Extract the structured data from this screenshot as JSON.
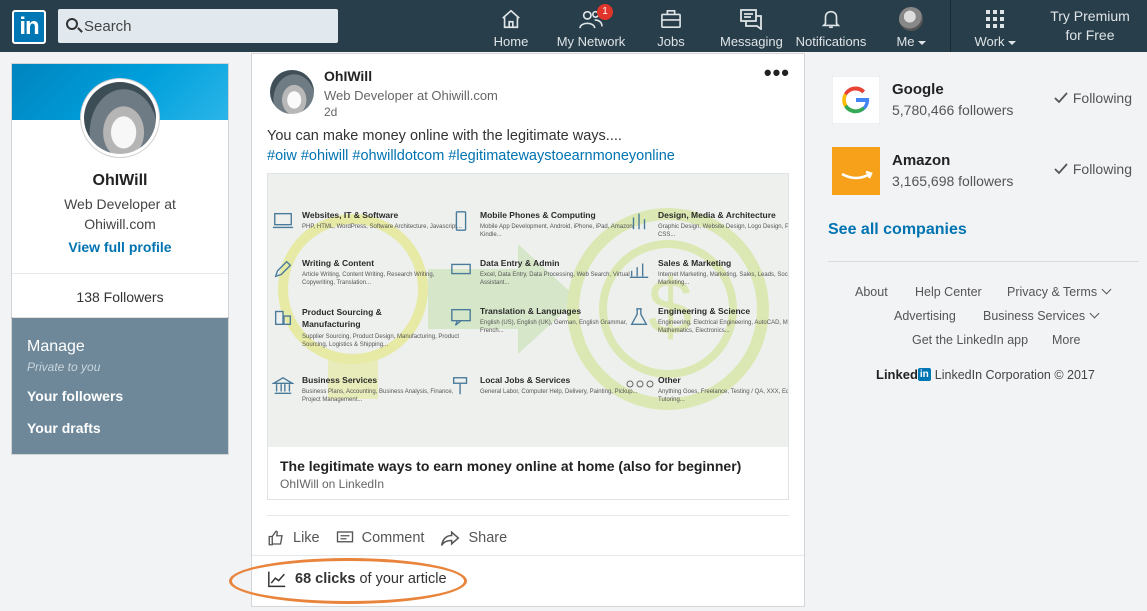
{
  "nav": {
    "logo_text": "in",
    "search_placeholder": "Search",
    "items": [
      {
        "label": "Home",
        "icon": "home-icon"
      },
      {
        "label": "My Network",
        "icon": "network-icon",
        "badge": "1"
      },
      {
        "label": "Jobs",
        "icon": "briefcase-icon"
      },
      {
        "label": "Messaging",
        "icon": "messaging-icon"
      },
      {
        "label": "Notifications",
        "icon": "bell-icon"
      },
      {
        "label": "Me",
        "icon": "avatar"
      },
      {
        "label": "Work",
        "icon": "grid-icon"
      }
    ],
    "premium_line1": "Try Premium",
    "premium_line2": "for Free"
  },
  "profile": {
    "name": "OhIWill",
    "headline": "Web Developer at Ohiwill.com",
    "view_link": "View full profile",
    "followers": "138 Followers"
  },
  "manage": {
    "title": "Manage",
    "subtitle": "Private to you",
    "link_followers": "Your followers",
    "link_drafts": "Your drafts"
  },
  "post": {
    "author": "OhIWill",
    "author_headline": "Web Developer at Ohiwill.com",
    "time": "2d",
    "more": "•••",
    "text": "You can make money online with the legitimate ways....",
    "hashtags": "#oiw #ohiwill #ohwilldotcom #legitimatewaystoearnmoneyonline",
    "article": {
      "title": "The legitimate ways to earn money online at home (also for beginner)",
      "source": "OhIWill on LinkedIn",
      "categories": [
        {
          "title": "Websites, IT & Software",
          "desc": "PHP, HTML, WordPress, Software Architecture, Javascript..."
        },
        {
          "title": "Writing & Content",
          "desc": "Article Writing, Content Writing, Research Writing, Copywriting, Translation..."
        },
        {
          "title": "Product Sourcing & Manufacturing",
          "desc": "Supplier Sourcing, Product Design, Manufacturing, Product Sourcing, Logistics & Shipping..."
        },
        {
          "title": "Business Services",
          "desc": "Business Plans, Accounting, Business Analysis, Finance, Project Management..."
        },
        {
          "title": "Mobile Phones & Computing",
          "desc": "Mobile App Development, Android, iPhone, iPad, Amazon Kindle..."
        },
        {
          "title": "Data Entry & Admin",
          "desc": "Excel, Data Entry, Data Processing, Web Search, Virtual Assistant..."
        },
        {
          "title": "Translation & Languages",
          "desc": "English (US), English (UK), German, English Grammar, French..."
        },
        {
          "title": "Local Jobs & Services",
          "desc": "General Labor, Computer Help, Delivery, Painting, Pickup..."
        },
        {
          "title": "Design, Media & Architecture",
          "desc": "Graphic Design, Website Design, Logo Design, Photoshop, CSS..."
        },
        {
          "title": "Sales & Marketing",
          "desc": "Internet Marketing, Marketing, Sales, Leads, Social Media Marketing..."
        },
        {
          "title": "Engineering & Science",
          "desc": "Engineering, Electrical Engineering, AutoCAD, Matlab and Mathematics, Electronics..."
        },
        {
          "title": "Other",
          "desc": "Anything Goes, Freelance, Testing / QA, XXX, Education & Tutoring..."
        }
      ]
    },
    "actions": {
      "like": "Like",
      "comment": "Comment",
      "share": "Share"
    },
    "clicks_count": "68 clicks",
    "clicks_suffix": "of your article"
  },
  "companies": [
    {
      "name": "Google",
      "followers": "5,780,466 followers",
      "status": "Following"
    },
    {
      "name": "Amazon",
      "followers": "3,165,698 followers",
      "status": "Following"
    }
  ],
  "see_all": "See all companies",
  "footer": {
    "about": "About",
    "help": "Help Center",
    "privacy": "Privacy & Terms",
    "advertising": "Advertising",
    "business": "Business Services",
    "app": "Get the LinkedIn app",
    "more": "More",
    "brand_word": "Linked",
    "brand_box": "in",
    "copyright": "LinkedIn Corporation © 2017"
  },
  "colors": {
    "nav_bg": "#283e4a",
    "link_blue": "#0073b1",
    "manage_bg": "#6e8899",
    "highlight": "#e8843b"
  }
}
